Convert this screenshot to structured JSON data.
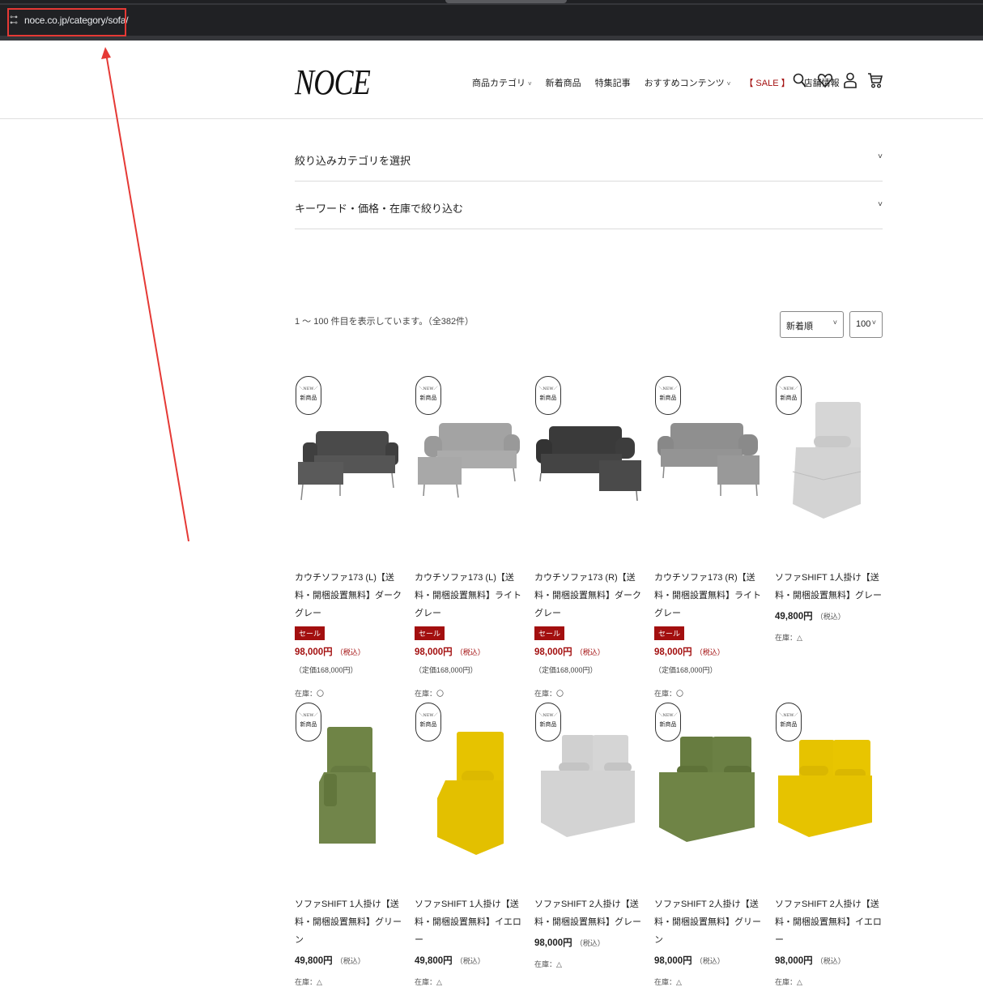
{
  "browser": {
    "url": "noce.co.jp/category/sofa/"
  },
  "header": {
    "logo": "NOCE",
    "nav": [
      {
        "label": "商品カテゴリ",
        "has_chevron": true
      },
      {
        "label": "新着商品",
        "has_chevron": false
      },
      {
        "label": "特集記事",
        "has_chevron": false
      },
      {
        "label": "おすすめコンテンツ",
        "has_chevron": true
      },
      {
        "label": "【 SALE 】",
        "has_chevron": false
      },
      {
        "label": "店舗情報",
        "has_chevron": false
      }
    ],
    "icons": [
      "search-icon",
      "heart-icon",
      "user-icon",
      "cart-icon"
    ]
  },
  "filters": {
    "category": "絞り込みカテゴリを選択",
    "keyword": "キーワード・価格・在庫で絞り込む",
    "toggle": "˅"
  },
  "listing": {
    "results_text": "1 ～ 100 件目を表示しています。（全382件）",
    "sort_value": "新着順",
    "per_page_value": "100",
    "chevron": "˅"
  },
  "badges": {
    "new_top": "＼NEW／",
    "new_main": "新商品",
    "sale": "セール",
    "tax": "（税込）"
  },
  "products": [
    {
      "name": "カウチソファ173 (L)【送料・開梱設置無料】ダークグレー",
      "sale": true,
      "price": "98,000円",
      "orig": "（定価168,000円）",
      "stock": "在庫：〇"
    },
    {
      "name": "カウチソファ173 (L)【送料・開梱設置無料】ライトグレー",
      "sale": true,
      "price": "98,000円",
      "orig": "（定価168,000円）",
      "stock": "在庫：〇"
    },
    {
      "name": "カウチソファ173 (R)【送料・開梱設置無料】ダークグレー",
      "sale": true,
      "price": "98,000円",
      "orig": "（定価168,000円）",
      "stock": "在庫：〇"
    },
    {
      "name": "カウチソファ173 (R)【送料・開梱設置無料】ライトグレー",
      "sale": true,
      "price": "98,000円",
      "orig": "（定価168,000円）",
      "stock": "在庫：〇"
    },
    {
      "name": "ソファSHIFT 1人掛け【送料・開梱設置無料】グレー",
      "sale": false,
      "price": "49,800円",
      "orig": "",
      "stock": "在庫：△"
    },
    {
      "name": "ソファSHIFT 1人掛け【送料・開梱設置無料】グリーン",
      "sale": false,
      "price": "49,800円",
      "orig": "",
      "stock": "在庫：△"
    },
    {
      "name": "ソファSHIFT 1人掛け【送料・開梱設置無料】イエロー",
      "sale": false,
      "price": "49,800円",
      "orig": "",
      "stock": "在庫：△"
    },
    {
      "name": "ソファSHIFT 2人掛け【送料・開梱設置無料】グレー",
      "sale": false,
      "price": "98,000円",
      "orig": "",
      "stock": "在庫：△"
    },
    {
      "name": "ソファSHIFT 2人掛け【送料・開梱設置無料】グリーン",
      "sale": false,
      "price": "98,000円",
      "orig": "",
      "stock": "在庫：△"
    },
    {
      "name": "ソファSHIFT 2人掛け【送料・開梱設置無料】イエロー",
      "sale": false,
      "price": "98,000円",
      "orig": "",
      "stock": "在庫：△"
    }
  ],
  "colors": {
    "sale_red": "#a30f0f",
    "annotation_red": "#e53935",
    "dark_gray": "#4a4a4a",
    "light_gray": "#9a9a9a",
    "pale_gray": "#d3d3d3",
    "green": "#6f8446",
    "yellow": "#e6c300"
  }
}
